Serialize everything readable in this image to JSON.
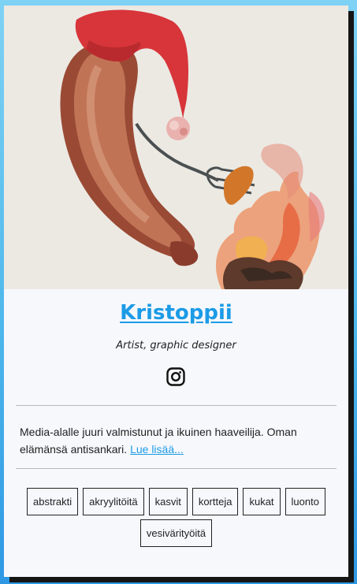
{
  "profile": {
    "name": "Kristoppii",
    "role": "Artist, graphic designer",
    "accent_color": "#1c9be6",
    "social_icon": "instagram-icon"
  },
  "bio": {
    "text": "Media-alalle juuri valmistunut ja ikuinen haaveilija. Oman elämänsä antisankari. ",
    "read_more": "Lue lisää..."
  },
  "tags": [
    "abstrakti",
    "akryylitöitä",
    "kasvit",
    "kortteja",
    "kukat",
    "luonto",
    "vesivärityöitä"
  ]
}
